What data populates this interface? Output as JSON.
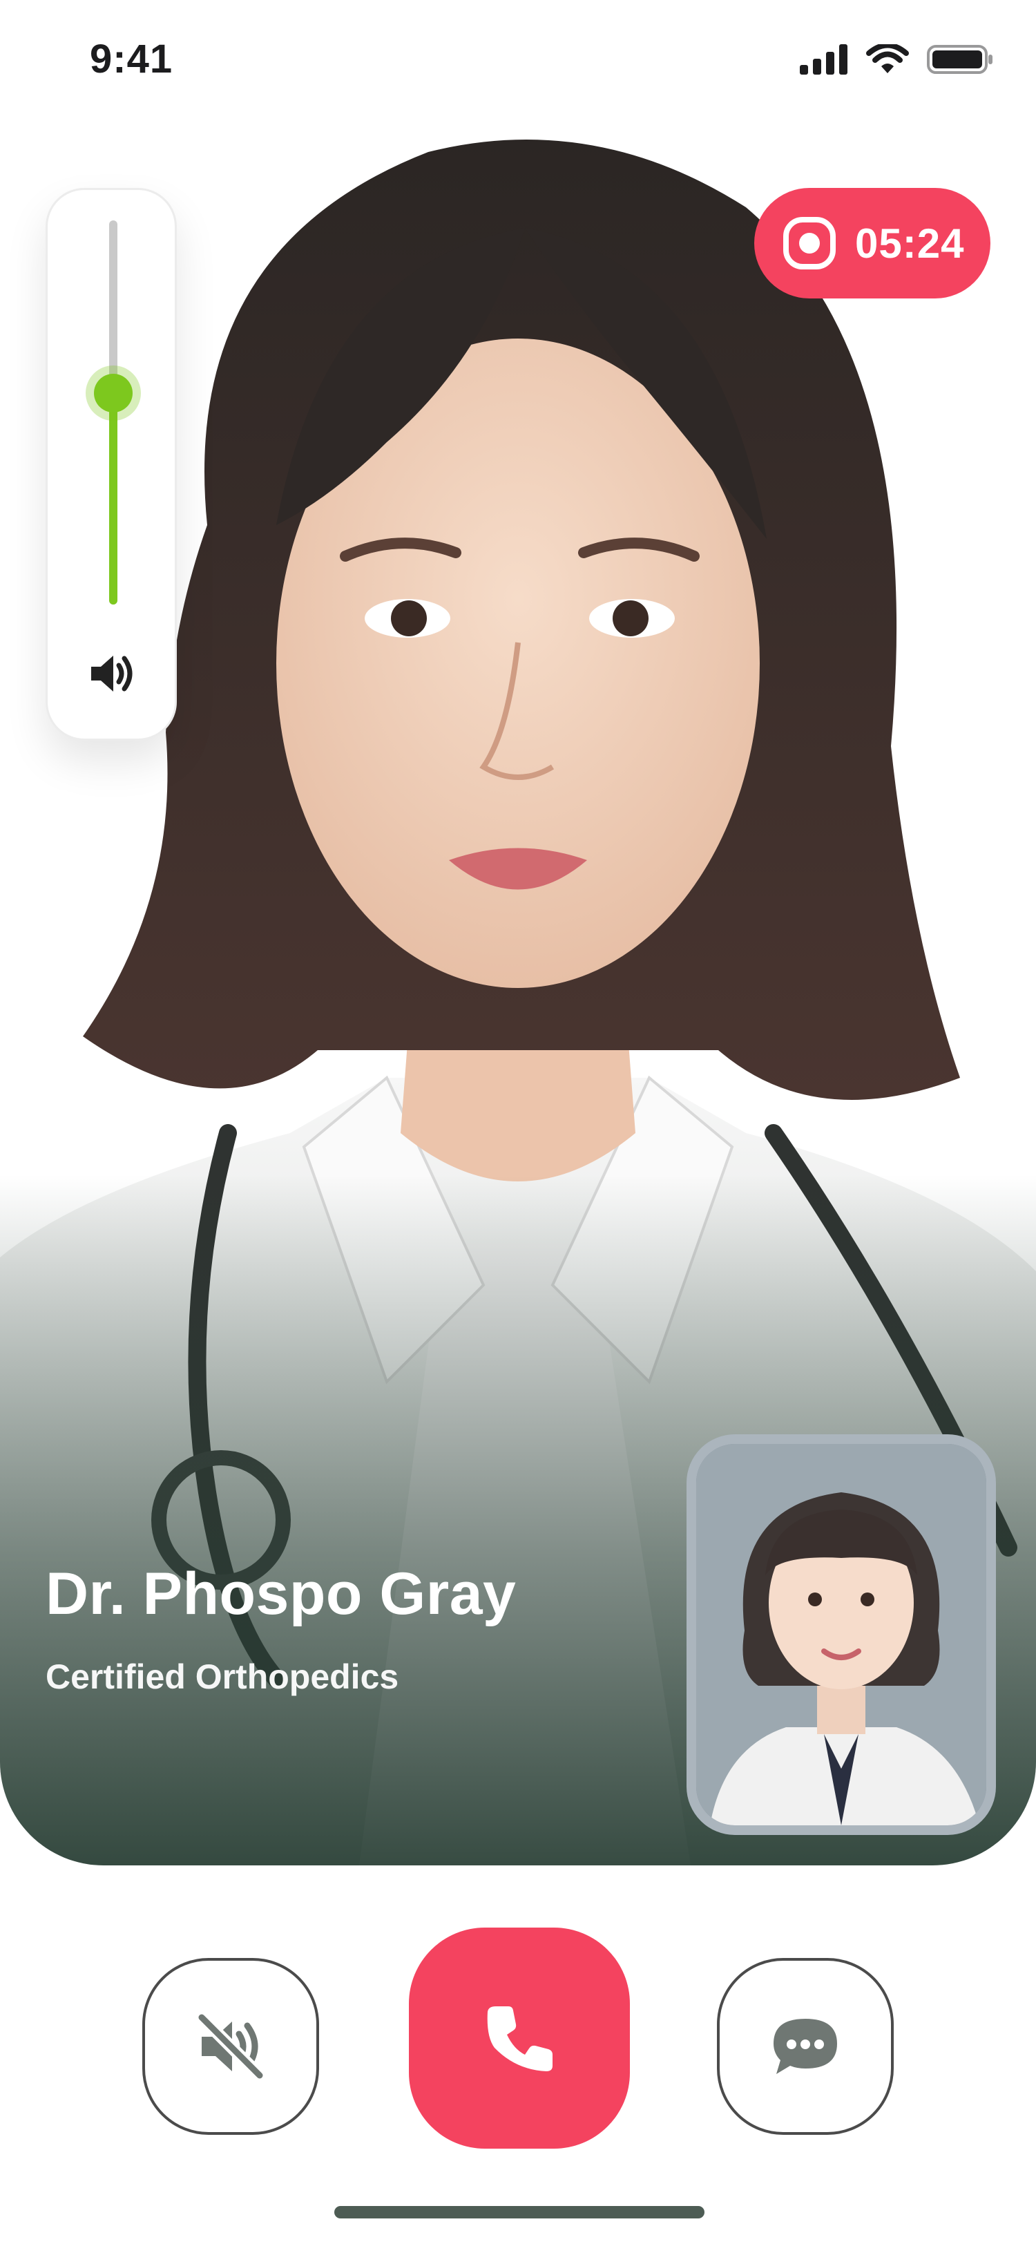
{
  "status_bar": {
    "time": "9:41"
  },
  "call": {
    "doctor_name": "Dr. Phospo Gray",
    "specialty": "Certified Orthopedics",
    "recording_time": "05:24",
    "volume_level": 0.55
  },
  "icons": {
    "signal": "signal-icon",
    "wifi": "wifi-icon",
    "battery": "battery-icon",
    "volume": "speaker-icon",
    "record": "record-icon",
    "mute": "speaker-muted-icon",
    "end_call": "phone-icon",
    "chat": "chat-bubble-icon"
  },
  "colors": {
    "accent_red": "#f4435f",
    "volume_green": "#7dc81e",
    "control_gray": "#6f7773",
    "text_dark": "#1c1c1e"
  }
}
